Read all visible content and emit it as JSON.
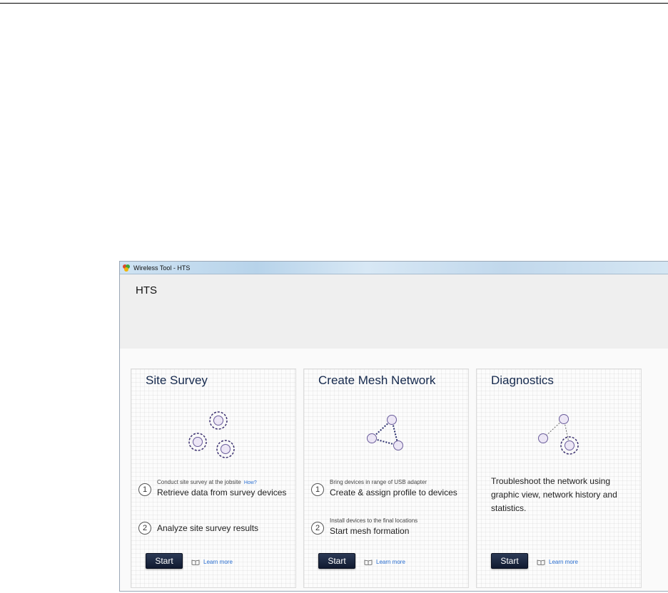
{
  "window": {
    "title": "Wireless Tool - HTS"
  },
  "header": {
    "title": "HTS"
  },
  "cards": [
    {
      "title": "Site Survey",
      "steps": [
        {
          "num": "1",
          "small": "Conduct site survey at the jobsite",
          "link": "How?",
          "main": "Retrieve data from survey devices"
        },
        {
          "num": "2",
          "small": "",
          "link": "",
          "main": "Analyze site survey results"
        }
      ],
      "start_label": "Start",
      "learn_more": "Learn more"
    },
    {
      "title": "Create Mesh Network",
      "steps": [
        {
          "num": "1",
          "small": "Bring devices in range of USB adapter",
          "link": "",
          "main": "Create & assign profile to devices"
        },
        {
          "num": "2",
          "small": "Install devices to the final locations",
          "link": "",
          "main": "Start mesh formation"
        }
      ],
      "start_label": "Start",
      "learn_more": "Learn more"
    },
    {
      "title": "Diagnostics",
      "description": "Troubleshoot the network using graphic view, network history and statistics.",
      "start_label": "Start",
      "learn_more": "Learn more"
    }
  ],
  "colors": {
    "accent_dark": "#15294d",
    "node_fill": "#ece6f5",
    "node_stroke": "#6a5c9a",
    "link": "#2a6fd1"
  },
  "icons": [
    "app-icon",
    "site-survey-illustration",
    "mesh-network-illustration",
    "diagnostics-illustration",
    "book-icon"
  ]
}
